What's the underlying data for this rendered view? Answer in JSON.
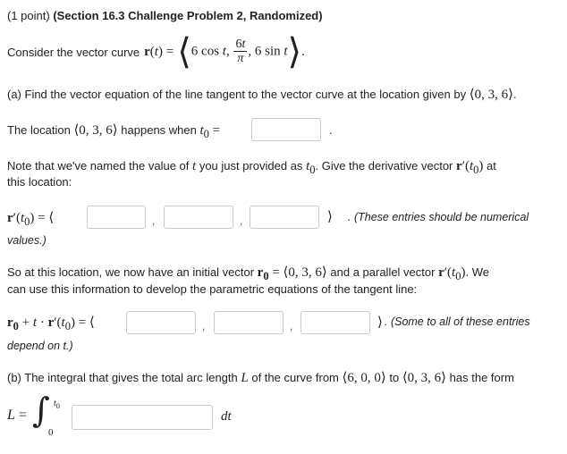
{
  "header": {
    "points": "(1 point)",
    "title": "(Section 16.3 Challenge Problem 2, Randomized)"
  },
  "intro": {
    "text": "Consider the vector curve"
  },
  "part_a": {
    "question": "(a) Find the vector equation of the line tangent to the vector curve at the location given by",
    "location_prefix": "The location",
    "location_mid": "happens when",
    "note_line1_pre": "Note that we've named the value of",
    "note_line1_mid": "you just provided as",
    "note_line1_post": ". Give the derivative vector",
    "note_line1_end": "at",
    "note_line2": "this location:",
    "numeric_note_1": ". (These entries should be numerical",
    "numeric_note_2": "values.)",
    "so_line1_pre": "So at this location, we now have an initial vector",
    "so_line1_mid": "and a parallel vector",
    "so_line1_end": ". We",
    "so_line2": "can use this information to develop the parametric equations of the tangent line:",
    "some_note_1": ". (Some to all of these entries",
    "some_note_2": "depend on t.)"
  },
  "part_b": {
    "question_pre": "(b) The integral that gives the total arc length",
    "question_mid": "of the curve from",
    "question_to": "to",
    "question_end": "has the form"
  },
  "inputs": {
    "t0": "",
    "deriv_1": "",
    "deriv_2": "",
    "deriv_3": "",
    "line_1": "",
    "line_2": "",
    "line_3": "",
    "integrand": ""
  }
}
